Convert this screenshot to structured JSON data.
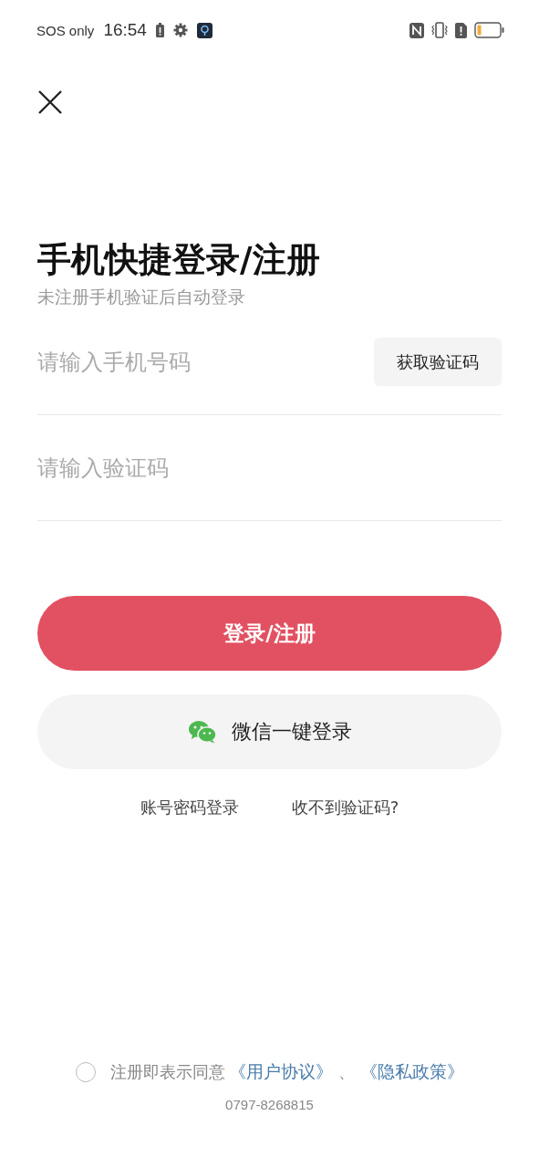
{
  "status_bar": {
    "carrier": "SOS only",
    "time": "16:54"
  },
  "title": "手机快捷登录/注册",
  "subtitle": "未注册手机验证后自动登录",
  "phone_field": {
    "placeholder": "请输入手机号码"
  },
  "get_code_button": "获取验证码",
  "code_field": {
    "placeholder": "请输入验证码"
  },
  "login_button": "登录/注册",
  "wechat_button": "微信一键登录",
  "links": [
    "账号密码登录",
    "收不到验证码?"
  ],
  "agreement": {
    "checked": false,
    "text": "注册即表示同意",
    "links": [
      "《用户协议》",
      "《隐私政策》"
    ],
    "separator": "、"
  },
  "phone_number": "0797-8268815"
}
